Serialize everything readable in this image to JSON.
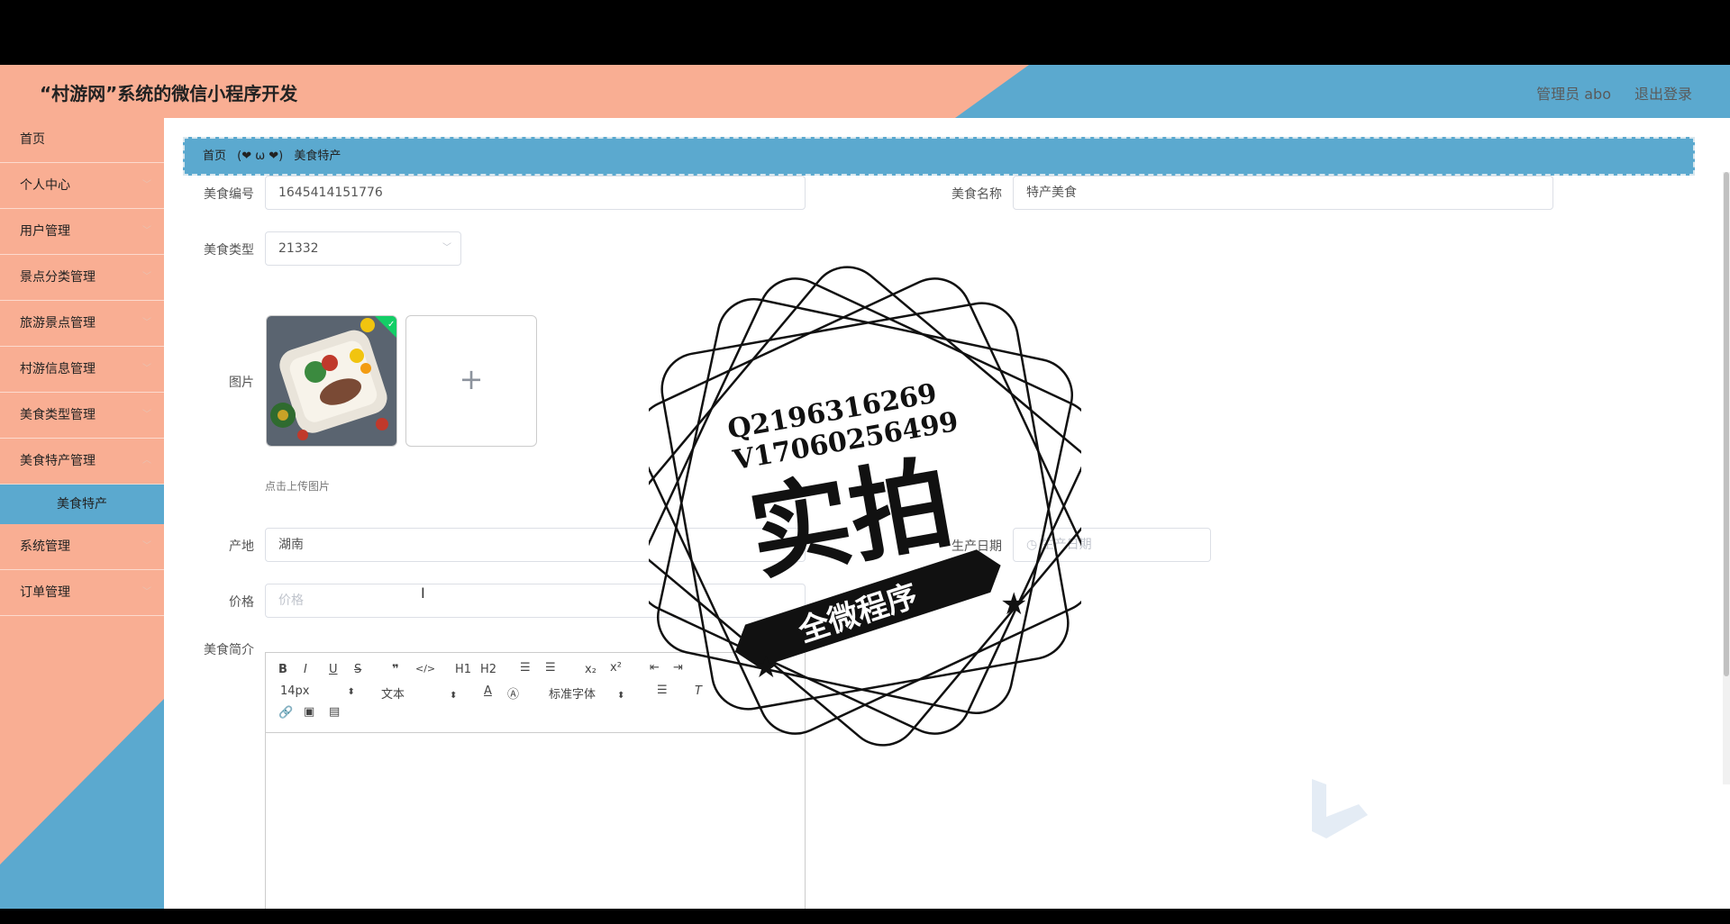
{
  "header": {
    "title": "“村游网”系统的微信小程序开发",
    "user": "管理员 abo",
    "logout": "退出登录"
  },
  "sidebar": {
    "items": [
      {
        "label": "首页",
        "expandable": false
      },
      {
        "label": "个人中心",
        "expandable": true
      },
      {
        "label": "用户管理",
        "expandable": true
      },
      {
        "label": "景点分类管理",
        "expandable": true
      },
      {
        "label": "旅游景点管理",
        "expandable": true
      },
      {
        "label": "村游信息管理",
        "expandable": true
      },
      {
        "label": "美食类型管理",
        "expandable": true
      },
      {
        "label": "美食特产管理",
        "expandable": true
      }
    ],
    "active_sub": "美食特产",
    "items_after": [
      {
        "label": "系统管理"
      },
      {
        "label": "订单管理"
      }
    ]
  },
  "breadcrumb": {
    "home": "首页",
    "separator": "(❤ ω ❤)",
    "current": "美食特产"
  },
  "form": {
    "code_label": "美食编号",
    "code_value": "1645414151776",
    "name_label": "美食名称",
    "name_value": "特产美食",
    "type_label": "美食类型",
    "type_value": "21332",
    "image_label": "图片",
    "upload_hint": "点击上传图片",
    "origin_label": "产地",
    "origin_value": "湖南",
    "date_label": "生产日期",
    "date_placeholder": "生产日期",
    "price_label": "价格",
    "price_placeholder": "价格",
    "intro_label": "美食简介"
  },
  "editor": {
    "font_size": "14px",
    "text_style": "文本",
    "font_family": "标准字体",
    "buttons": [
      "B",
      "I",
      "U",
      "S",
      "❞",
      "</>",
      "H1",
      "H2",
      "ordered-list",
      "bullet-list",
      "x₂",
      "x²",
      "outdent",
      "indent",
      "font-color",
      "bg-color",
      "align",
      "clear-format",
      "link",
      "image",
      "video"
    ]
  },
  "watermark": {
    "line1": "Q2196316269",
    "line2": "V17060256499",
    "big": "实拍",
    "ribbon": "全微程序"
  },
  "colors": {
    "salmon": "#f9ae93",
    "blue": "#5ba9cf"
  }
}
